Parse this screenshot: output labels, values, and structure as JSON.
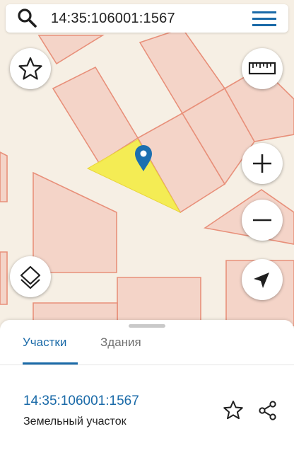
{
  "search": {
    "query": "14:35:106001:1567",
    "icon": "search-icon"
  },
  "menu": {
    "icon": "hamburger-menu-icon"
  },
  "map_controls": {
    "favorite_icon": "star-outline-icon",
    "ruler_icon": "ruler-icon",
    "zoom_in_icon": "plus-icon",
    "zoom_out_icon": "minus-icon",
    "layers_icon": "layers-icon",
    "locate_icon": "navigation-arrow-icon",
    "marker_icon": "map-pin-icon"
  },
  "colors": {
    "map_background": "#f6efe4",
    "parcel_fill": "#f4d4c8",
    "parcel_stroke": "#e8907a",
    "selected_parcel": "#f3ec48",
    "accent": "#1a6aa8"
  },
  "sheet": {
    "tabs": [
      {
        "label": "Участки",
        "active": true
      },
      {
        "label": "Здания",
        "active": false
      }
    ],
    "result": {
      "cadastral_number": "14:35:106001:1567",
      "type": "Земельный участок",
      "favorite_icon": "star-outline-icon",
      "share_icon": "share-icon"
    }
  }
}
